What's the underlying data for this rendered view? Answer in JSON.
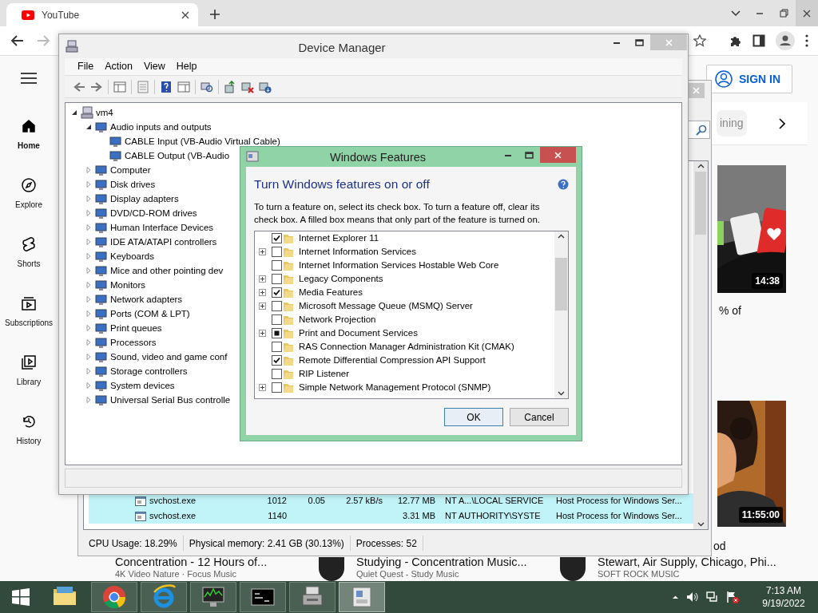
{
  "browser": {
    "tab_title": "YouTube"
  },
  "youtube": {
    "sidebar": [
      {
        "kind": "home",
        "label": "Home",
        "selected": true
      },
      {
        "kind": "explore",
        "label": "Explore",
        "selected": false
      },
      {
        "kind": "shorts",
        "label": "Shorts",
        "selected": false
      },
      {
        "kind": "subscriptions",
        "label": "Subscriptions",
        "selected": false
      },
      {
        "kind": "library",
        "label": "Library",
        "selected": false
      },
      {
        "kind": "history",
        "label": "History",
        "selected": false
      }
    ],
    "sign_in": "SIGN IN",
    "chip": "ining",
    "title_fragments": [
      "% of",
      "od"
    ],
    "thumbnails": [
      {
        "duration": "14:38"
      },
      {
        "duration": "11:55:00"
      }
    ],
    "videos": [
      {
        "avatar": false,
        "title": "Concentration - 12 Hours of...",
        "channel": "4K Video Nature · Focus Music"
      },
      {
        "avatar": true,
        "title": "Studying - Concentration Music...",
        "channel": "Quiet Quest - Study Music"
      },
      {
        "avatar": true,
        "title": "Stewart, Air Supply, Chicago, Phi...",
        "channel": "SOFT ROCK MUSIC"
      }
    ]
  },
  "task_manager": {
    "processes": [
      {
        "name": "svchost.exe",
        "pid": "1012",
        "cpu": "0.05",
        "network": "2.57 kB/s",
        "memory": "12.77 MB",
        "user": "NT A...\\LOCAL SERVICE",
        "description": "Host Process for Windows Ser..."
      },
      {
        "name": "svchost.exe",
        "pid": "1140",
        "memory": "3.31 MB",
        "user": "NT AUTHORITY\\SYSTE",
        "description": "Host Process for Windows Ser..."
      }
    ],
    "status_bar": [
      "CPU Usage: 18.29%",
      "Physical memory: 2.41 GB (30.13%)",
      "Processes: 52"
    ]
  },
  "device_manager": {
    "title": "Device Manager",
    "menu": [
      "File",
      "Action",
      "View",
      "Help"
    ],
    "tree": [
      {
        "label": "vm4",
        "expanded": true,
        "children": [
          {
            "label": "Audio inputs and outputs",
            "expanded": true,
            "children": [
              {
                "label": "CABLE Input (VB-Audio Virtual Cable)"
              },
              {
                "label": "CABLE Output (VB-Audio"
              }
            ]
          },
          {
            "label": "Computer",
            "expanded": false
          },
          {
            "label": "Disk drives",
            "expanded": false
          },
          {
            "label": "Display adapters",
            "expanded": false
          },
          {
            "label": "DVD/CD-ROM drives",
            "expanded": false
          },
          {
            "label": "Human Interface Devices",
            "expanded": false
          },
          {
            "label": "IDE ATA/ATAPI controllers",
            "expanded": false
          },
          {
            "label": "Keyboards",
            "expanded": false
          },
          {
            "label": "Mice and other pointing dev",
            "expanded": false
          },
          {
            "label": "Monitors",
            "expanded": false
          },
          {
            "label": "Network adapters",
            "expanded": false
          },
          {
            "label": "Ports (COM & LPT)",
            "expanded": false
          },
          {
            "label": "Print queues",
            "expanded": false
          },
          {
            "label": "Processors",
            "expanded": false
          },
          {
            "label": "Sound, video and game conf",
            "expanded": false
          },
          {
            "label": "Storage controllers",
            "expanded": false
          },
          {
            "label": "System devices",
            "expanded": false
          },
          {
            "label": "Universal Serial Bus controlle",
            "expanded": false
          }
        ]
      }
    ]
  },
  "windows_features": {
    "title": "Windows Features",
    "heading": "Turn Windows features on or off",
    "description": "To turn a feature on, select its check box. To turn a feature off, clear its check box. A filled box means that only part of the feature is turned on.",
    "features": [
      {
        "label": "Internet Explorer 11",
        "expandable": false,
        "checked": true,
        "partial": false
      },
      {
        "label": "Internet Information Services",
        "expandable": true,
        "checked": false,
        "partial": false
      },
      {
        "label": "Internet Information Services Hostable Web Core",
        "expandable": false,
        "checked": false,
        "partial": false
      },
      {
        "label": "Legacy Components",
        "expandable": true,
        "checked": false,
        "partial": false
      },
      {
        "label": "Media Features",
        "expandable": true,
        "checked": true,
        "partial": false
      },
      {
        "label": "Microsoft Message Queue (MSMQ) Server",
        "expandable": true,
        "checked": false,
        "partial": false
      },
      {
        "label": "Network Projection",
        "expandable": false,
        "checked": false,
        "partial": false
      },
      {
        "label": "Print and Document Services",
        "expandable": true,
        "checked": false,
        "partial": true
      },
      {
        "label": "RAS Connection Manager Administration Kit (CMAK)",
        "expandable": false,
        "checked": false,
        "partial": false
      },
      {
        "label": "Remote Differential Compression API Support",
        "expandable": false,
        "checked": true,
        "partial": false
      },
      {
        "label": "RIP Listener",
        "expandable": false,
        "checked": false,
        "partial": false
      },
      {
        "label": "Simple Network Management Protocol (SNMP)",
        "expandable": true,
        "checked": false,
        "partial": false
      }
    ],
    "buttons": [
      {
        "label": "OK",
        "default": true
      },
      {
        "label": "Cancel",
        "default": false
      }
    ]
  },
  "taskbar": {
    "apps": [
      {
        "kind": "explorer",
        "running": false,
        "selected": false
      },
      {
        "kind": "chrome",
        "running": true,
        "selected": false
      },
      {
        "kind": "ie",
        "running": true,
        "selected": false
      },
      {
        "kind": "taskmgr",
        "running": true,
        "selected": false
      },
      {
        "kind": "cmd",
        "running": true,
        "selected": false
      },
      {
        "kind": "devmgr",
        "running": true,
        "selected": false
      },
      {
        "kind": "features",
        "running": true,
        "selected": true
      }
    ],
    "time": "7:13 AM",
    "date": "9/19/2022"
  }
}
